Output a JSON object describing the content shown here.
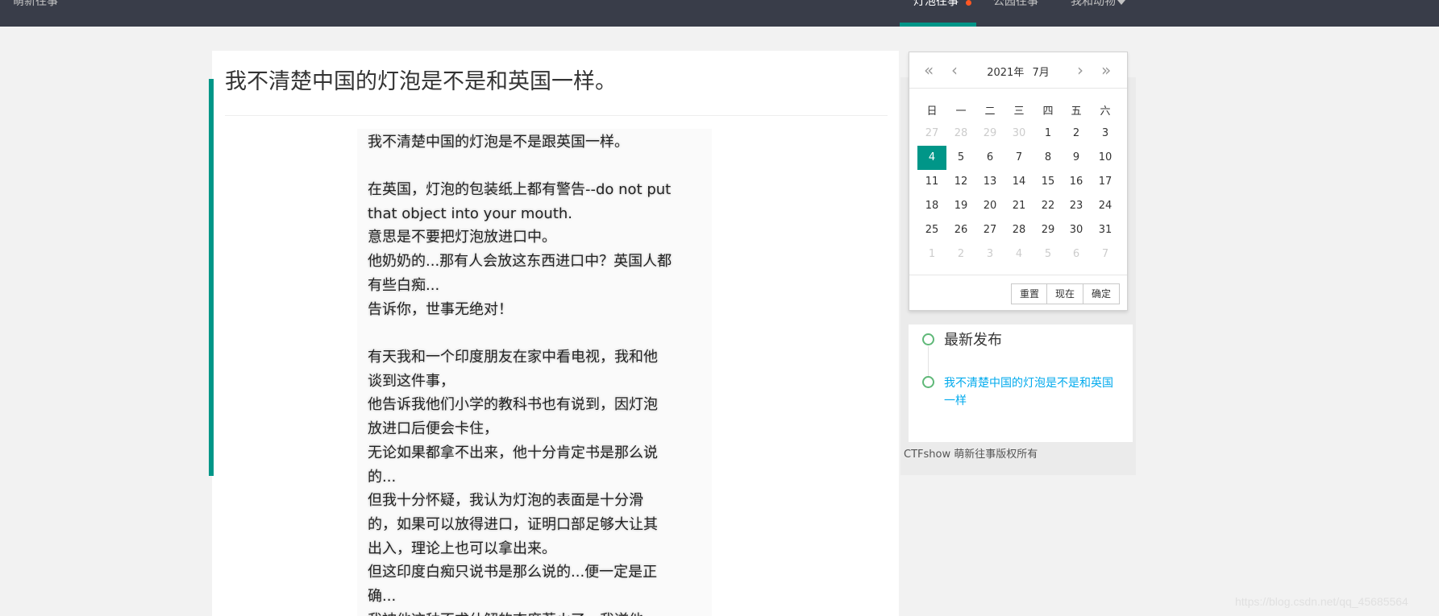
{
  "nav": {
    "brand": "萌新往事",
    "items": [
      {
        "label": "灯泡往事"
      },
      {
        "label": "公园往事"
      },
      {
        "label": "我和动物"
      }
    ]
  },
  "post": {
    "title": "我不清楚中国的灯泡是不是和英国一样。",
    "lines": [
      "我不清楚中国的灯泡是不是跟英国一样。",
      "在英国，灯泡的包装纸上都有警告--do not put",
      "that object into your mouth.",
      "意思是不要把灯泡放进口中。",
      "他奶奶的...那有人会放这东西进口中？英国人都",
      "有些白痴...",
      "告诉你，世事无绝对！",
      "有天我和一个印度朋友在家中看电视，我和他",
      "谈到这件事，",
      "他告诉我他们小学的教科书也有说到，因灯泡",
      "放进口后便会卡住，",
      "无论如果都拿不出来，他十分肯定书是那么说",
      "的...",
      "但我十分怀疑，我认为灯泡的表面是十分滑",
      "的，如果可以放得进口，证明口部足够大让其",
      "出入，理论上也可以拿出来。",
      "但这印度白痴只说书是那么说的...便一定是正",
      "确...",
      "我被他这种不求什解的态度惹火了，我逆他"
    ]
  },
  "calendar": {
    "year": "2021年",
    "month": "7月",
    "weekdays": [
      "日",
      "一",
      "二",
      "三",
      "四",
      "五",
      "六"
    ],
    "days": [
      [
        "27",
        "28",
        "29",
        "30",
        "1",
        "2",
        "3"
      ],
      [
        "4",
        "5",
        "6",
        "7",
        "8",
        "9",
        "10"
      ],
      [
        "11",
        "12",
        "13",
        "14",
        "15",
        "16",
        "17"
      ],
      [
        "18",
        "19",
        "20",
        "21",
        "22",
        "23",
        "24"
      ],
      [
        "25",
        "26",
        "27",
        "28",
        "29",
        "30",
        "31"
      ],
      [
        "1",
        "2",
        "3",
        "4",
        "5",
        "6",
        "7"
      ]
    ],
    "selected": "4",
    "buttons": {
      "reset": "重置",
      "now": "现在",
      "confirm": "确定"
    },
    "nav_prev_year": "«",
    "nav_prev_month": "‹",
    "nav_next_month": "›",
    "nav_next_year": "»"
  },
  "latest": {
    "title": "最新发布",
    "link": "我不清楚中国的灯泡是不是和英国一样"
  },
  "footer": {
    "copyright": "CTFshow 萌新往事版权所有"
  },
  "watermark": "https://blog.csdn.net/qq_45685564",
  "colors": {
    "nav_bg": "#393d49",
    "accent": "#009688",
    "notify_dot": "#ff5722",
    "link": "#01aaed",
    "timeline": "#5fb878"
  }
}
